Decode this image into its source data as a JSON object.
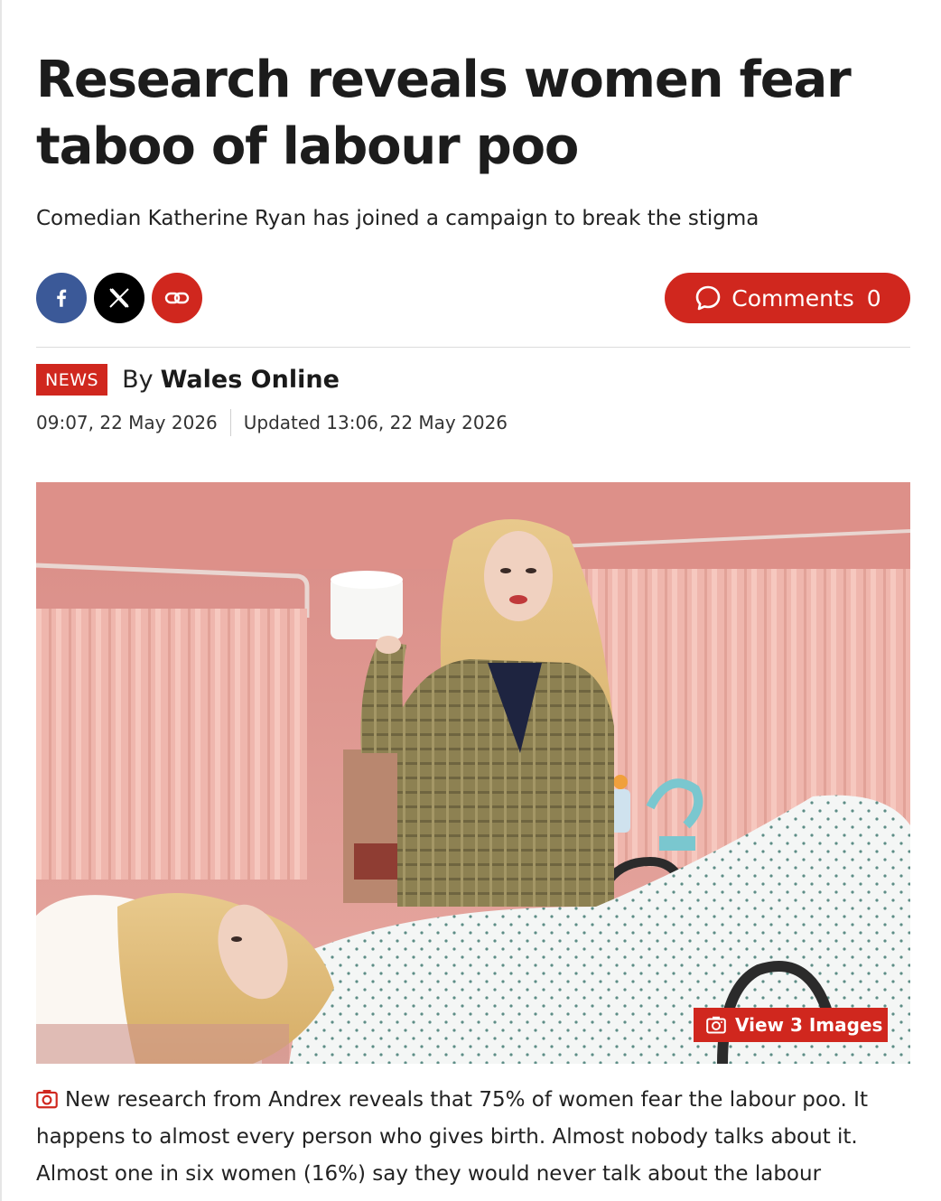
{
  "article": {
    "headline": "Research reveals women fear taboo of labour poo",
    "standfirst": "Comedian Katherine Ryan has joined a campaign to break the stigma",
    "section_badge": "NEWS",
    "by_prefix": "By",
    "author": "Wales Online",
    "published": "09:07, 22 May 2026",
    "updated": "Updated 13:06, 22 May 2026",
    "caption": "New research from Andrex reveals that 75% of women fear the labour poo. It happens to almost every person who gives birth. Almost nobody talks about it. Almost one in six women (16%) say they would never talk about the labour"
  },
  "share": {
    "facebook_icon": "facebook-icon",
    "x_icon": "x-icon",
    "link_icon": "link-icon"
  },
  "comments": {
    "label": "Comments",
    "count": "0"
  },
  "gallery": {
    "view_label": "View 3 Images"
  },
  "colors": {
    "accent": "#d0271e",
    "facebook": "#3b5998",
    "x": "#000000"
  }
}
